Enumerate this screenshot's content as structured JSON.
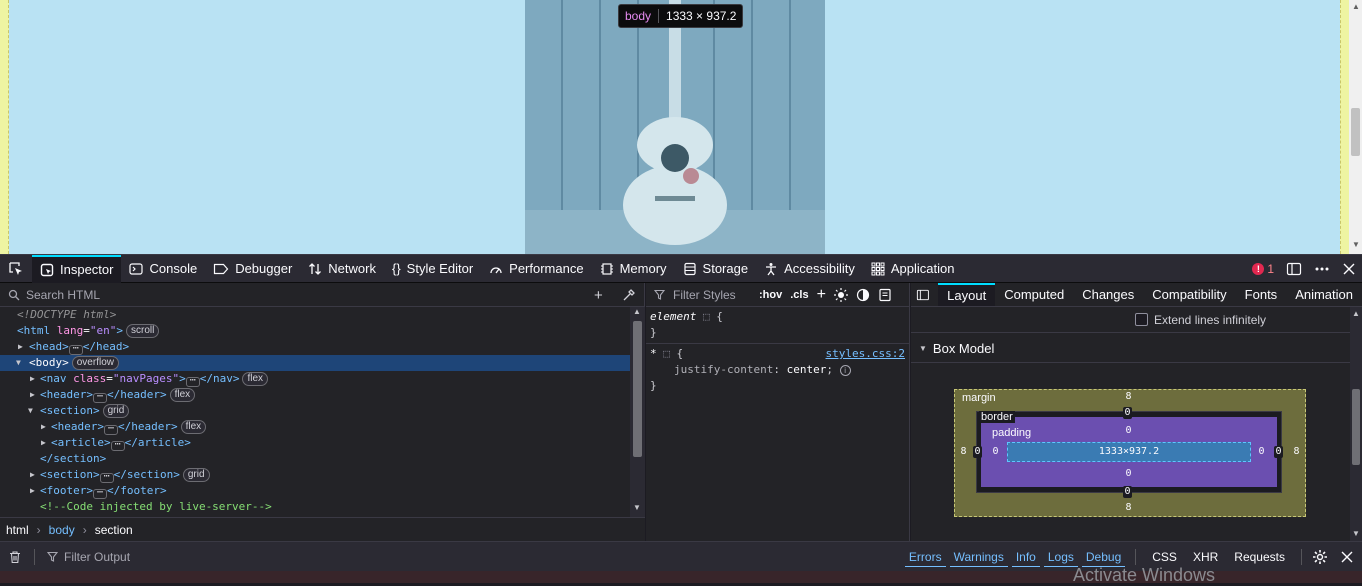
{
  "tooltip": {
    "tag": "body",
    "dims": "1333 × 937.2"
  },
  "toolbar": {
    "tabs": [
      {
        "label": "Inspector",
        "icon": "inspector-icon"
      },
      {
        "label": "Console",
        "icon": "console-icon"
      },
      {
        "label": "Debugger",
        "icon": "debugger-icon"
      },
      {
        "label": "Network",
        "icon": "network-icon"
      },
      {
        "label": "Style Editor",
        "icon": "style-editor-icon"
      },
      {
        "label": "Performance",
        "icon": "performance-icon"
      },
      {
        "label": "Memory",
        "icon": "memory-icon"
      },
      {
        "label": "Storage",
        "icon": "storage-icon"
      },
      {
        "label": "Accessibility",
        "icon": "accessibility-icon"
      },
      {
        "label": "Application",
        "icon": "application-icon"
      }
    ],
    "error_count": "1"
  },
  "markup": {
    "search_placeholder": "Search HTML",
    "lines": {
      "doctype": "<!DOCTYPE html>",
      "html_open": "<html",
      "html_attr": "lang",
      "html_val": "\"en\"",
      "html_close": ">",
      "html_badge": "scroll",
      "head": "<head>",
      "head_end": "</head>",
      "body": "<body>",
      "body_badge": "overflow",
      "nav_open": "<nav",
      "nav_attr": "class",
      "nav_val": "\"navPages\"",
      "nav_gt": ">",
      "nav_end": "</nav>",
      "nav_badge": "flex",
      "header": "<header>",
      "header_end": "</header>",
      "header_badge": "flex",
      "section": "<section>",
      "section_badge": "grid",
      "inner_header": "<header>",
      "inner_header_end": "</header>",
      "inner_header_badge": "flex",
      "article": "<article>",
      "article_end": "</article>",
      "section_end": "</section>",
      "section2": "<section>",
      "section2_end": "</section>",
      "section2_badge": "grid",
      "footer": "<footer>",
      "footer_end": "</footer>",
      "comment": "<!--Code injected by live-server-->"
    },
    "ellipsis": "⋯"
  },
  "breadcrumbs": [
    "html",
    "body",
    "section"
  ],
  "rules": {
    "filter_placeholder": "Filter Styles",
    "hov": ":hov",
    "cls": ".cls",
    "element_selector": "element",
    "star_selector": "*",
    "source": "styles.css:2",
    "prop": "justify-content",
    "val": "center"
  },
  "layout": {
    "tabs": [
      "Layout",
      "Computed",
      "Changes",
      "Compatibility",
      "Fonts",
      "Animation"
    ],
    "extend_label": "Extend lines infinitely",
    "box_model_title": "Box Model",
    "labels": {
      "margin": "margin",
      "border": "border",
      "padding": "padding"
    },
    "content": "1333×937.2",
    "margin": {
      "top": "8",
      "right": "8",
      "bottom": "8",
      "left": "8"
    },
    "border": {
      "top": "0",
      "right": "0",
      "bottom": "0",
      "left": "0"
    },
    "padding": {
      "top": "0",
      "right": "0",
      "bottom": "0",
      "left": "0"
    }
  },
  "console": {
    "filter_placeholder": "Filter Output",
    "filters": [
      "Errors",
      "Warnings",
      "Info",
      "Logs",
      "Debug"
    ],
    "toggles": [
      "CSS",
      "XHR",
      "Requests"
    ]
  },
  "watermark": "Activate Windows",
  "colors": {
    "accent": "#00ddff",
    "selection": "#1e4578",
    "viewport_bg": "#b9e2f3"
  }
}
